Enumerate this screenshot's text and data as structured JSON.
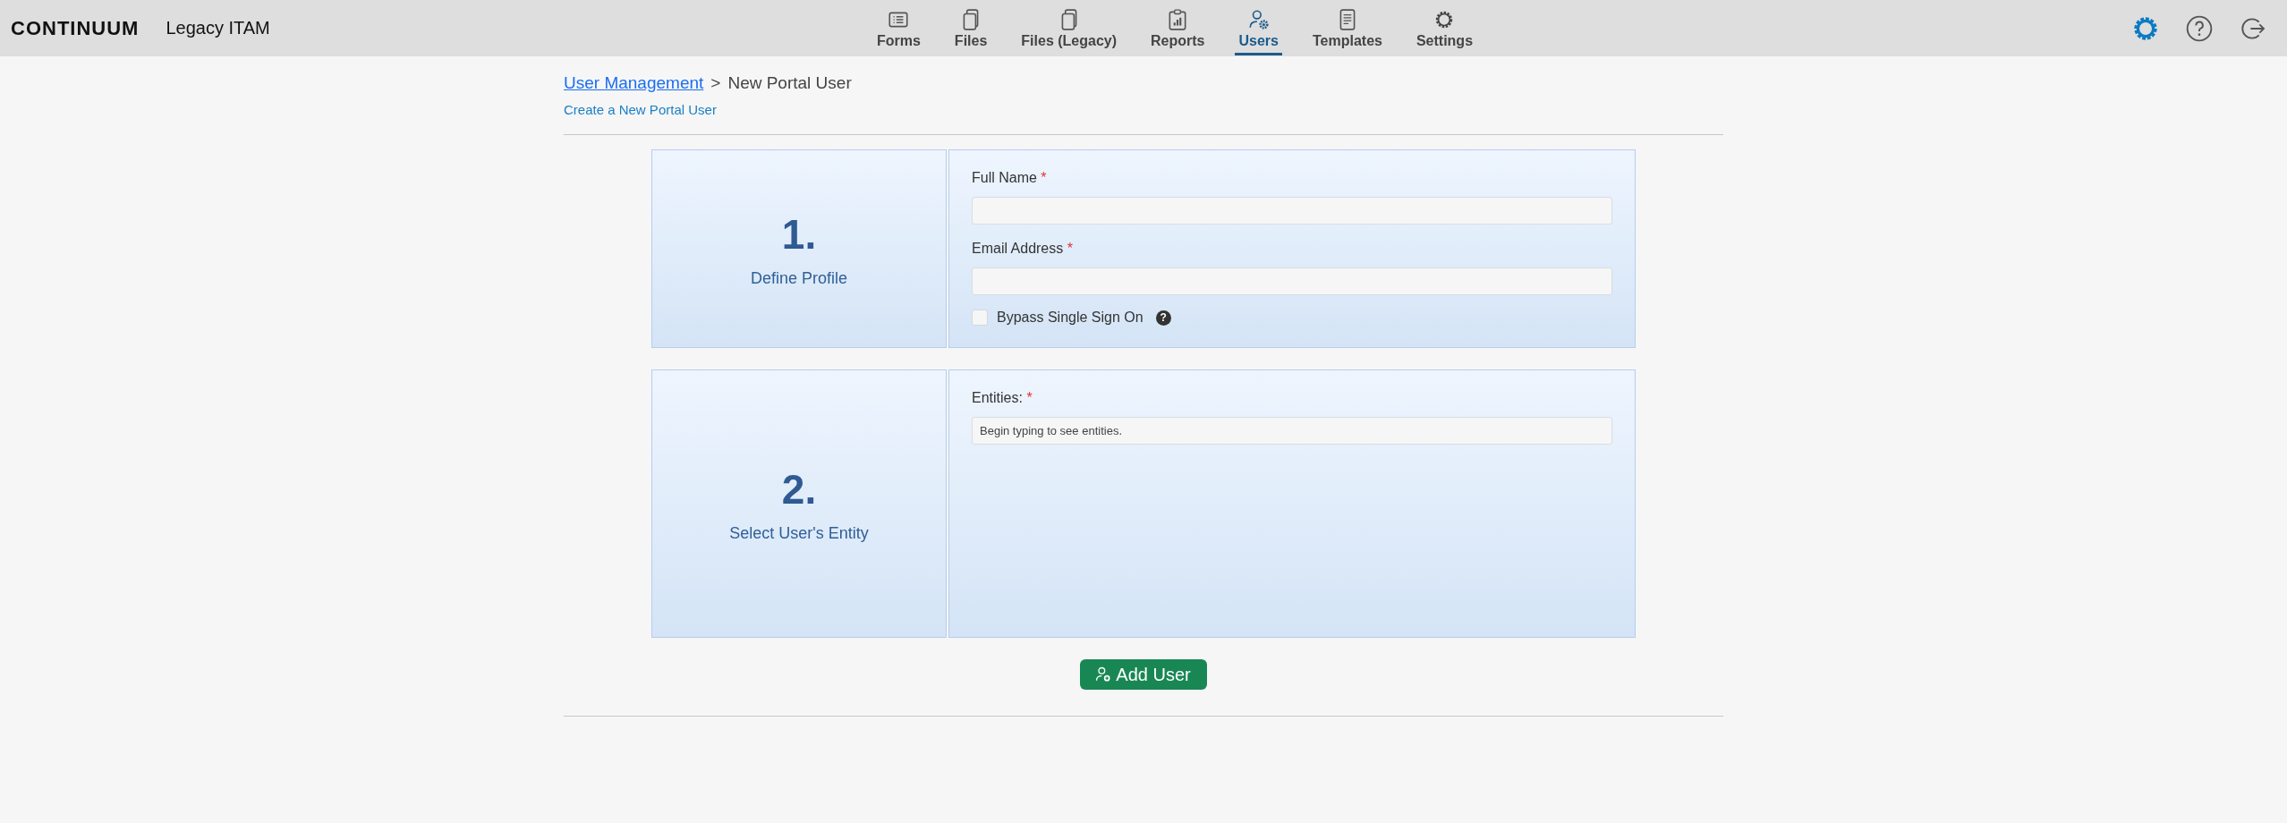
{
  "header": {
    "logo": "CONTINUUM",
    "app_name": "Legacy ITAM",
    "nav": [
      {
        "label": "Forms",
        "selected": false
      },
      {
        "label": "Files",
        "selected": false
      },
      {
        "label": "Files (Legacy)",
        "selected": false
      },
      {
        "label": "Reports",
        "selected": false
      },
      {
        "label": "Users",
        "selected": true
      },
      {
        "label": "Templates",
        "selected": false
      },
      {
        "label": "Settings",
        "selected": false
      }
    ]
  },
  "breadcrumb": {
    "link": "User Management",
    "separator": ">",
    "current": "New Portal User"
  },
  "subtitle": "Create a New Portal User",
  "steps": [
    {
      "number": "1.",
      "title": "Define Profile",
      "fields": [
        {
          "kind": "text",
          "label": "Full Name",
          "required_mark": "*"
        },
        {
          "kind": "text",
          "label": "Email Address",
          "required_mark": "*"
        },
        {
          "kind": "checkbox",
          "label": "Bypass Single Sign On",
          "checked": false,
          "help": "?"
        }
      ]
    },
    {
      "number": "2.",
      "title": "Select User's Entity",
      "fields": [
        {
          "kind": "text",
          "label": "Entities:",
          "required_mark": "*",
          "placeholder": "Begin typing to see entities."
        }
      ]
    }
  ],
  "add_button": "Add User"
}
